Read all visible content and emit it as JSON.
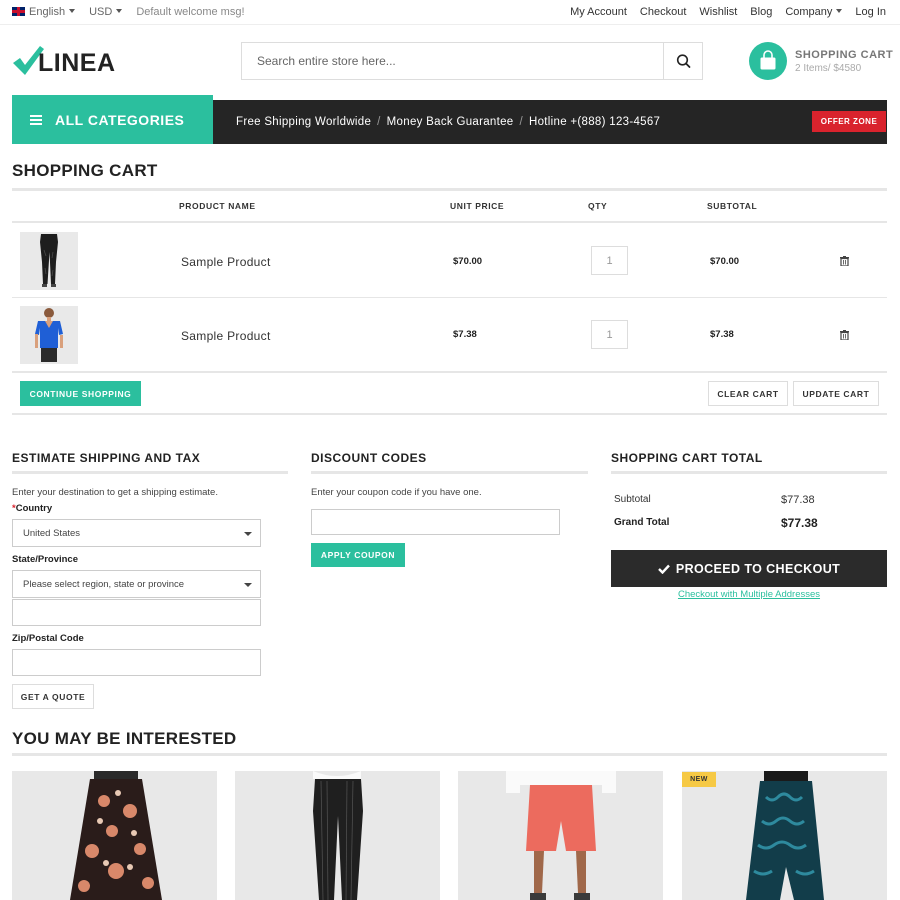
{
  "topbar": {
    "language": "English",
    "currency": "USD",
    "welcome": "Default welcome msg!",
    "links": [
      "My Account",
      "Checkout",
      "Wishlist",
      "Blog",
      "Company",
      "Log In"
    ]
  },
  "header": {
    "logo": "LINEA",
    "search_placeholder": "Search entire store here...",
    "cart_title": "SHOPPING CART",
    "cart_summary": "2 Items/ $4580"
  },
  "nav": {
    "all_categories": "ALL CATEGORIES",
    "info": [
      "Free Shipping Worldwide",
      "Money Back Guarantee",
      "Hotline +(888) 123-4567"
    ],
    "separator": "/",
    "offer": "OFFER ZONE"
  },
  "cart": {
    "title": "SHOPPING CART",
    "columns": {
      "name": "PRODUCT NAME",
      "unit_price": "UNIT PRICE",
      "qty": "QTY",
      "subtotal": "SUBTOTAL"
    },
    "items": [
      {
        "name": "Sample Product",
        "unit_price": "$70.00",
        "qty": "1",
        "subtotal": "$70.00",
        "image": "black-pants"
      },
      {
        "name": "Sample Product",
        "unit_price": "$7.38",
        "qty": "1",
        "subtotal": "$7.38",
        "image": "blue-top"
      }
    ],
    "continue": "CONTINUE SHOPPING",
    "clear": "CLEAR CART",
    "update": "UPDATE CART"
  },
  "shipping": {
    "title": "ESTIMATE SHIPPING AND TAX",
    "desc": "Enter your destination to get a shipping estimate.",
    "country_label": "Country",
    "required_mark": "*",
    "country_value": "United States",
    "state_label": "State/Province",
    "state_value": "Please select region, state or province",
    "zip_label": "Zip/Postal Code",
    "quote": "GET A QUOTE"
  },
  "discount": {
    "title": "DISCOUNT CODES",
    "desc": "Enter your coupon code if you have one.",
    "apply": "APPLY COUPON"
  },
  "totals": {
    "title": "SHOPPING CART TOTAL",
    "subtotal_label": "Subtotal",
    "subtotal": "$77.38",
    "grand_label": "Grand Total",
    "grand": "$77.38",
    "checkout": "PROCEED TO CHECKOUT",
    "multi": "Checkout with Multiple Addresses"
  },
  "related": {
    "title": "YOU MAY BE INTERESTED",
    "badge": "NEW",
    "products": [
      "floral-maxi-skirt",
      "pinstripe-pants",
      "coral-shorts",
      "teal-print-skirt"
    ]
  },
  "colors": {
    "accent": "#2bbf9e",
    "dark": "#252525",
    "offer": "#d9232d",
    "badge": "#f6c945"
  }
}
